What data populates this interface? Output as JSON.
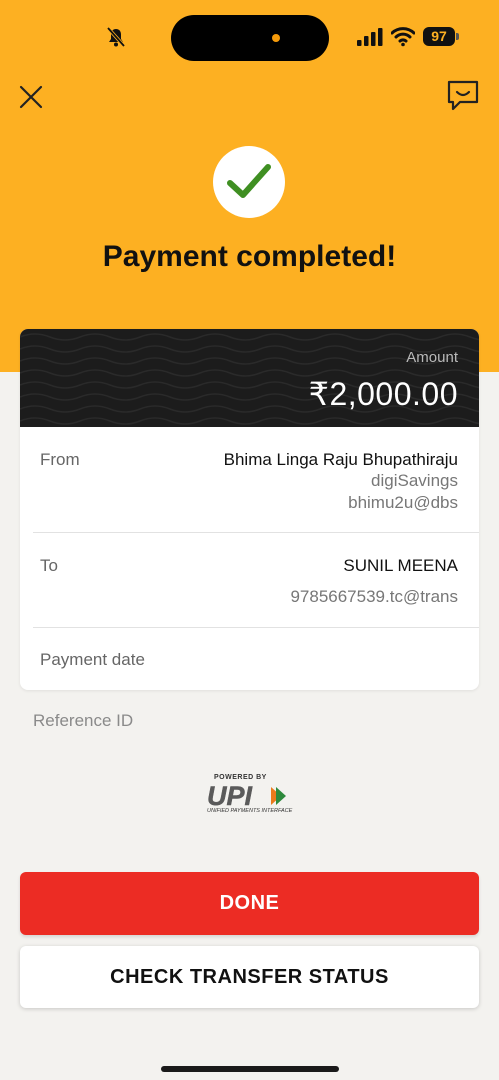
{
  "status_bar": {
    "battery_level": "97"
  },
  "header": {
    "title": "Payment completed!"
  },
  "amount": {
    "label": "Amount",
    "value": "₹2,000.00"
  },
  "from": {
    "label": "From",
    "name": "Bhima Linga Raju Bhupathiraju",
    "account": "digiSavings",
    "vpa": "bhimu2u@dbs"
  },
  "to": {
    "label": "To",
    "name": "SUNIL MEENA",
    "vpa": "9785667539.tc@trans"
  },
  "payment_date": {
    "label": "Payment date"
  },
  "reference": {
    "label": "Reference ID"
  },
  "upi_logo": {
    "top_text": "POWERED BY",
    "mark": "UPI",
    "bottom_text": "UNIFIED PAYMENTS INTERFACE"
  },
  "buttons": {
    "done": "DONE",
    "check_status": "CHECK TRANSFER STATUS"
  },
  "colors": {
    "header_bg": "#fdb022",
    "primary_button": "#ec2c24",
    "success_check": "#3f8f22",
    "amount_band": "#1c1c1c"
  },
  "icons": [
    "bell-slash-icon",
    "signal-icon",
    "wifi-icon",
    "battery-icon",
    "close-icon",
    "chat-icon",
    "checkmark-icon"
  ]
}
